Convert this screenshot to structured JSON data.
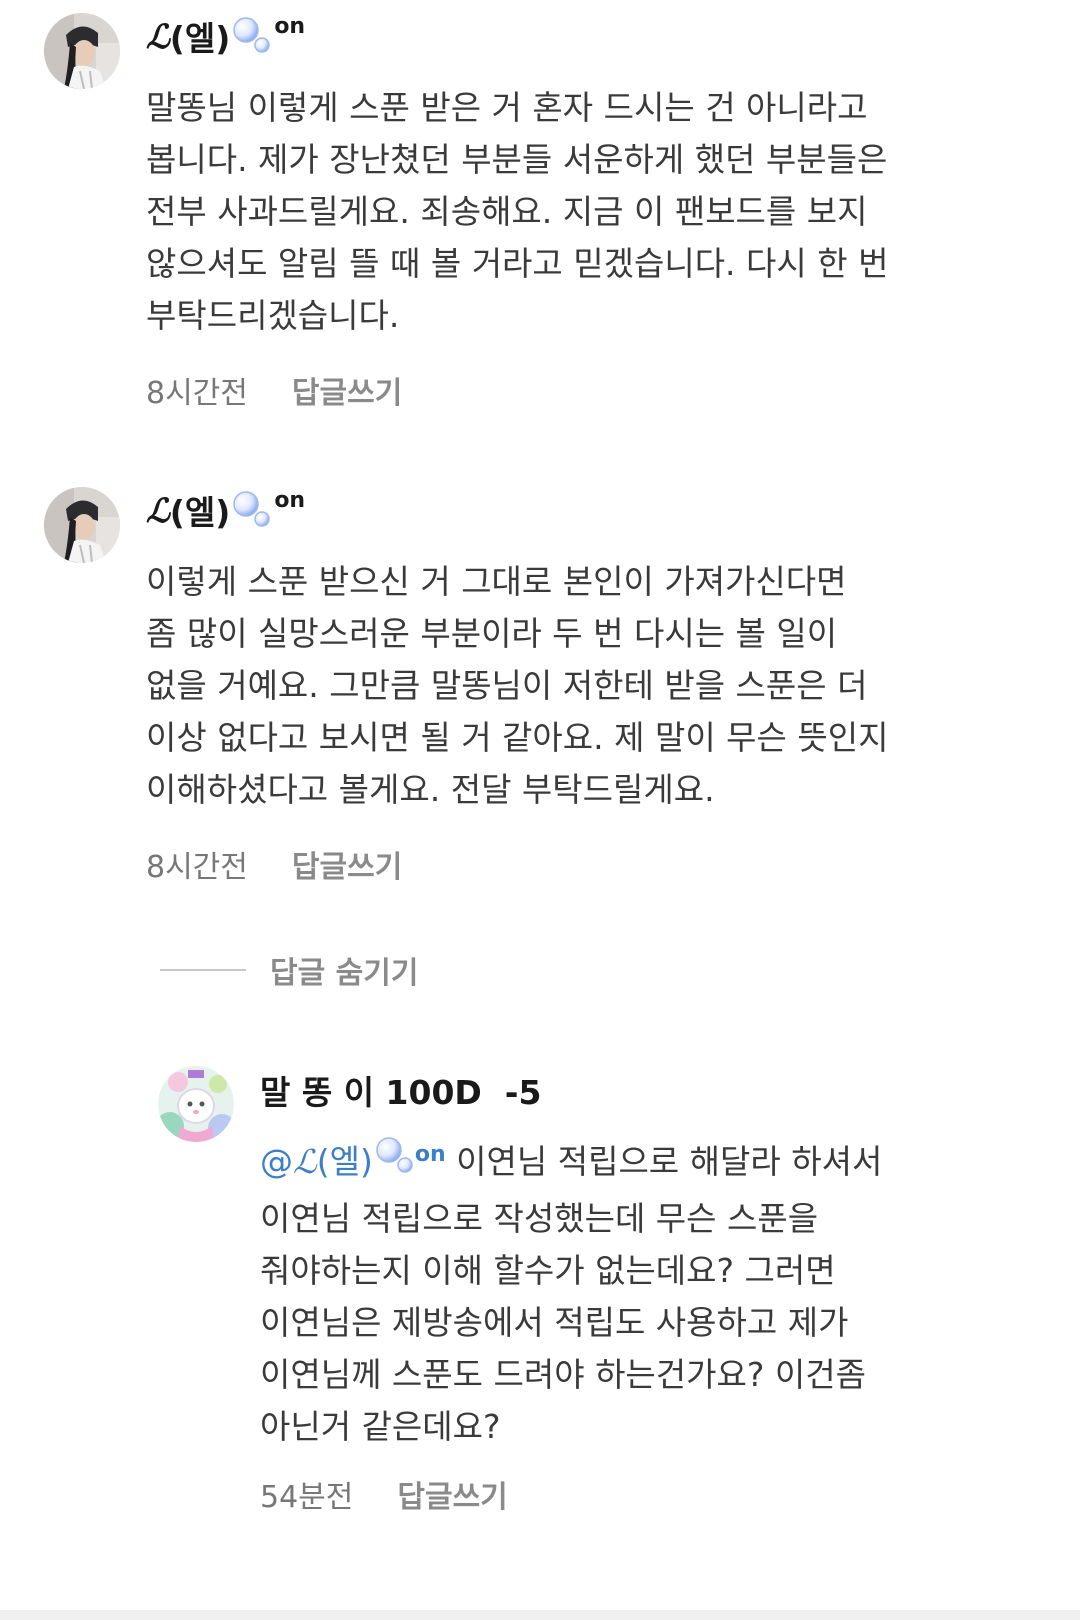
{
  "comments": [
    {
      "nickname_script": "ℒ",
      "nickname_rest": "(엘)",
      "nickname_on": "on",
      "text": "말똥님 이렇게 스푼 받은 거 혼자 드시는 건 아니라고\n봅니다. 제가 장난쳤던 부분들 서운하게 했던 부분들은\n전부 사과드릴게요. 죄송해요. 지금 이 팬보드를 보지\n않으셔도 알림 뜰 때 볼 거라고 믿겠습니다. 다시 한 번\n부탁드리겠습니다.",
      "time": "8시간전",
      "reply_label": "답글쓰기"
    },
    {
      "nickname_script": "ℒ",
      "nickname_rest": "(엘)",
      "nickname_on": "on",
      "text": "이렇게 스푼 받으신 거 그대로 본인이 가져가신다면\n좀 많이 실망스러운 부분이라 두 번 다시는 볼 일이\n없을 거예요. 그만큼 말똥님이 저한테 받을 스푼은 더\n이상 없다고 보시면 될 거 같아요. 제 말이 무슨 뜻인지\n이해하셨다고 볼게요. 전달 부탁드릴게요.",
      "time": "8시간전",
      "reply_label": "답글쓰기"
    }
  ],
  "hide_replies_label": "답글 숨기기",
  "reply": {
    "nickname": "말 똥 이 100D  -5",
    "mention_at": "@",
    "mention_script": "ℒ",
    "mention_rest": "(엘)",
    "mention_on": "on",
    "text_first": " 이연님 적립으로 해달라 하셔서",
    "text_rest": "이연님 적립으로 작성했는데 무슨 스푼을\n줘야하는지 이해 할수가 없는데요? 그러면\n이연님은 제방송에서 적립도 사용하고 제가\n이연님께 스푼도 드려야 하는건가요? 이건좀\n아닌거 같은데요?",
    "time": "54분전",
    "reply_label": "답글쓰기"
  },
  "colors": {
    "mention": "#3d7fc7",
    "secondary_text": "#8a8a8a"
  },
  "icons": {
    "bubbles": "bubbles-icon",
    "avatar_user": "avatar-photo",
    "avatar_reply": "avatar-illustration"
  }
}
